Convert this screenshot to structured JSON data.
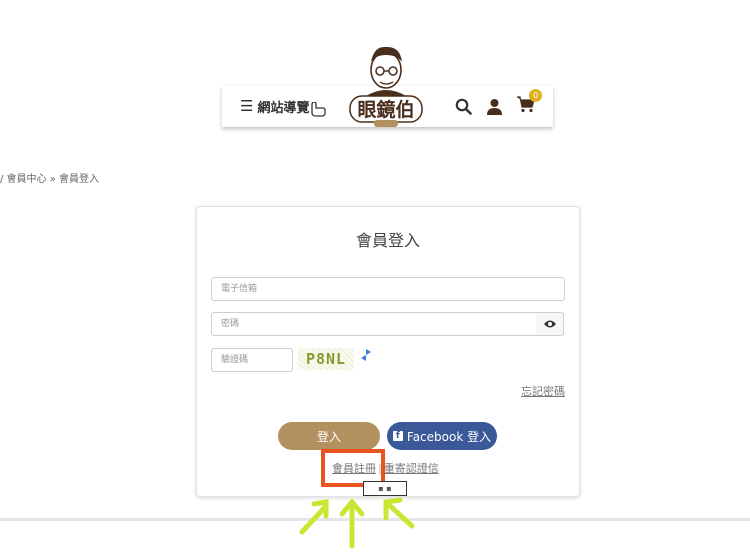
{
  "header": {
    "nav_label": "網站導覽",
    "logo_text": "眼鏡伯",
    "cart_count": "0",
    "icons": [
      "menu-icon",
      "hand-pointer-icon",
      "search-icon",
      "user-icon",
      "cart-icon"
    ]
  },
  "breadcrumb": "/ 會員中心 » 會員登入",
  "login": {
    "title": "會員登入",
    "email_placeholder": "電子信箱",
    "password_placeholder": "密碼",
    "captcha_placeholder": "驗證碼",
    "captcha_text": "P8NL",
    "forgot_label": "忘記密碼",
    "login_button": "登入",
    "facebook_button": "Facebook 登入",
    "register_link": "會員註冊",
    "resend_link": "重寄認證信"
  },
  "colors": {
    "login_button": "#b3905f",
    "facebook_button": "#3b5998",
    "highlight": "#e8541e",
    "arrows": "#c8e632",
    "cart_badge": "#e0b020"
  }
}
